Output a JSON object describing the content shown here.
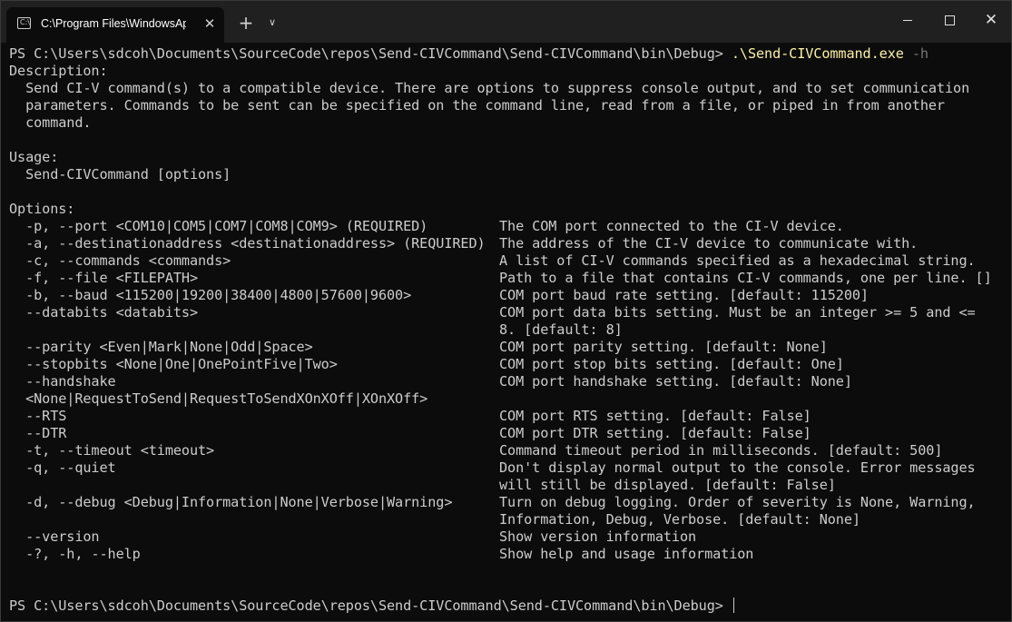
{
  "titlebar": {
    "tab_icon_glyph": "C:\\",
    "tab_title": "C:\\Program Files\\WindowsAp",
    "close_tab_glyph": "✕",
    "new_tab_glyph": "+",
    "dropdown_glyph": "∨",
    "close_window_glyph": "✕"
  },
  "terminal": {
    "prompt": "PS C:\\Users\\sdcoh\\Documents\\SourceCode\\repos\\Send-CIVCommand\\Send-CIVCommand\\bin\\Debug>",
    "command": ".\\Send-CIVCommand.exe",
    "command_flag": "-h",
    "description_header": "Description:",
    "description_lines": [
      "  Send CI-V command(s) to a compatible device. There are options to suppress console output, and to set communication",
      "  parameters. Commands to be sent can be specified on the command line, read from a file, or piped in from another",
      "  command."
    ],
    "usage_header": "Usage:",
    "usage_line": "  Send-CIVCommand [options]",
    "options_header": "Options:",
    "options": [
      {
        "opt": "  -p, --port <COM10|COM5|COM7|COM8|COM9> (REQUIRED)",
        "desc": [
          "The COM port connected to the CI-V device."
        ]
      },
      {
        "opt": "  -a, --destinationaddress <destinationaddress> (REQUIRED)",
        "desc": [
          "The address of the CI-V device to communicate with."
        ]
      },
      {
        "opt": "  -c, --commands <commands>",
        "desc": [
          "A list of CI-V commands specified as a hexadecimal string."
        ]
      },
      {
        "opt": "  -f, --file <FILEPATH>",
        "desc": [
          "Path to a file that contains CI-V commands, one per line. []"
        ]
      },
      {
        "opt": "  -b, --baud <115200|19200|38400|4800|57600|9600>",
        "desc": [
          "COM port baud rate setting. [default: 115200]"
        ]
      },
      {
        "opt": "  --databits <databits>",
        "desc": [
          "COM port data bits setting. Must be an integer >= 5 and <=",
          "8. [default: 8]"
        ]
      },
      {
        "opt": "  --parity <Even|Mark|None|Odd|Space>",
        "desc": [
          "COM port parity setting. [default: None]"
        ]
      },
      {
        "opt": "  --stopbits <None|One|OnePointFive|Two>",
        "desc": [
          "COM port stop bits setting. [default: One]"
        ]
      },
      {
        "opt": "  --handshake",
        "desc": [
          "COM port handshake setting. [default: None]"
        ]
      },
      {
        "opt": "  <None|RequestToSend|RequestToSendXOnXOff|XOnXOff>",
        "desc": []
      },
      {
        "opt": "  --RTS",
        "desc": [
          "COM port RTS setting. [default: False]"
        ]
      },
      {
        "opt": "  --DTR",
        "desc": [
          "COM port DTR setting. [default: False]"
        ]
      },
      {
        "opt": "  -t, --timeout <timeout>",
        "desc": [
          "Command timeout period in milliseconds. [default: 500]"
        ]
      },
      {
        "opt": "  -q, --quiet",
        "desc": [
          "Don't display normal output to the console. Error messages",
          "will still be displayed. [default: False]"
        ]
      },
      {
        "opt": "  -d, --debug <Debug|Information|None|Verbose|Warning>",
        "desc": [
          "Turn on debug logging. Order of severity is None, Warning,",
          "Information, Debug, Verbose. [default: None]"
        ]
      },
      {
        "opt": "  --version",
        "desc": [
          "Show version information"
        ]
      },
      {
        "opt": "  -?, -h, --help",
        "desc": [
          "Show help and usage information"
        ]
      }
    ],
    "final_prompt": "PS C:\\Users\\sdcoh\\Documents\\SourceCode\\repos\\Send-CIVCommand\\Send-CIVCommand\\bin\\Debug>"
  },
  "colors": {
    "background": "#0c0c0c",
    "titlebar": "#202020",
    "text": "#cccccc",
    "command": "#f9f1a5",
    "flag": "#767676"
  }
}
